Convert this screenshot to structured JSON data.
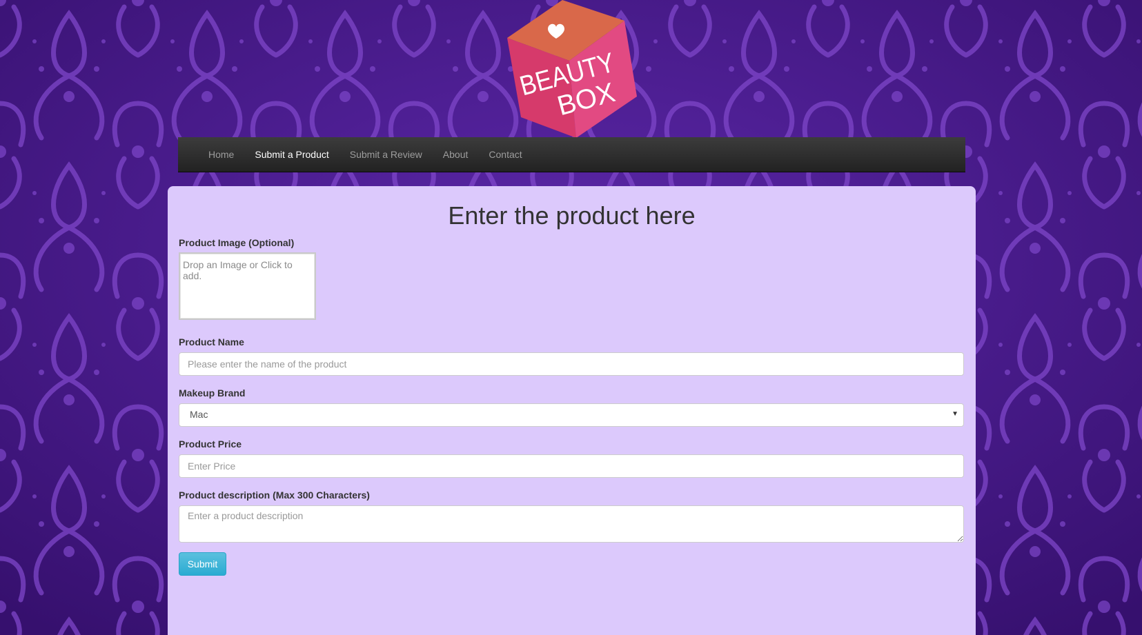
{
  "brand": {
    "logo_line1": "BEAUTY",
    "logo_line2": "BOX"
  },
  "colors": {
    "background": "#4a1d8f",
    "panel": "#dcc9fc",
    "navbar": "#2a2a2a",
    "button": "#31b0d5",
    "logo_top": "#d9684a",
    "logo_front": "#d63a6b"
  },
  "nav": {
    "items": [
      {
        "label": "Home"
      },
      {
        "label": "Submit a Product",
        "active": true
      },
      {
        "label": "Submit a Review"
      },
      {
        "label": "About"
      },
      {
        "label": "Contact"
      }
    ]
  },
  "form": {
    "title": "Enter the product here",
    "image_label": "Product Image (Optional)",
    "image_placeholder": "Drop an Image or Click to add.",
    "name_label": "Product Name",
    "name_placeholder": "Please enter the name of the product",
    "brand_label": "Makeup Brand",
    "brand_selected": "Mac",
    "price_label": "Product Price",
    "price_placeholder": "Enter Price",
    "description_label": "Product description (Max 300 Characters)",
    "description_placeholder": "Enter a product description",
    "submit_label": "Submit"
  }
}
